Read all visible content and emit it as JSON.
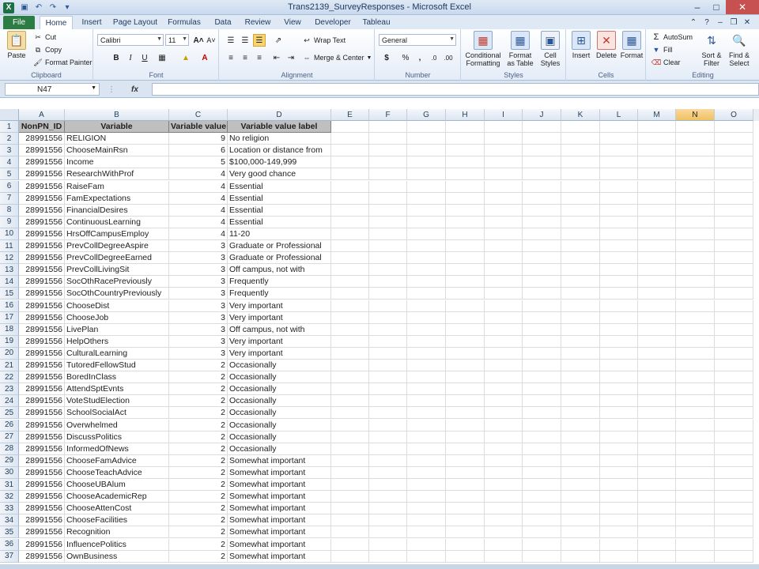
{
  "window": {
    "title": "Trans2139_SurveyResponses - Microsoft Excel",
    "app_icon": "X"
  },
  "tabs": {
    "file": "File",
    "items": [
      "Home",
      "Insert",
      "Page Layout",
      "Formulas",
      "Data",
      "Review",
      "View",
      "Developer",
      "Tableau"
    ],
    "active": "Home"
  },
  "ribbon": {
    "clipboard": {
      "label": "Clipboard",
      "paste": "Paste",
      "cut": "Cut",
      "copy": "Copy",
      "format_painter": "Format Painter"
    },
    "font": {
      "label": "Font",
      "name": "Calibri",
      "size": "11",
      "bold": "B",
      "italic": "I",
      "underline": "U"
    },
    "alignment": {
      "label": "Alignment",
      "wrap_text": "Wrap Text",
      "merge_center": "Merge & Center"
    },
    "number": {
      "label": "Number",
      "format": "General",
      "currency": "$",
      "percent": "%",
      "comma": ","
    },
    "styles": {
      "label": "Styles",
      "conditional_1": "Conditional",
      "conditional_2": "Formatting",
      "format_table_1": "Format",
      "format_table_2": "as Table",
      "cell_styles_1": "Cell",
      "cell_styles_2": "Styles"
    },
    "cells": {
      "label": "Cells",
      "insert": "Insert",
      "delete": "Delete",
      "format": "Format"
    },
    "editing": {
      "label": "Editing",
      "autosum": "AutoSum",
      "fill": "Fill",
      "clear": "Clear",
      "sort_1": "Sort &",
      "sort_2": "Filter",
      "find_1": "Find &",
      "find_2": "Select"
    }
  },
  "formula_bar": {
    "name_box": "N47",
    "fx": "fx",
    "content": ""
  },
  "columns": [
    "A",
    "B",
    "C",
    "D",
    "E",
    "F",
    "G",
    "H",
    "I",
    "J",
    "K",
    "L",
    "M",
    "N",
    "O"
  ],
  "selected_column": "N",
  "header_row": [
    "NonPN_ID",
    "Variable",
    "Variable value",
    "Variable value label"
  ],
  "rows": [
    [
      "28991556",
      "RELIGION",
      "9",
      "No religion"
    ],
    [
      "28991556",
      "ChooseMainRsn",
      "6",
      "Location or distance from"
    ],
    [
      "28991556",
      "Income",
      "5",
      "$100,000-149,999"
    ],
    [
      "28991556",
      "ResearchWithProf",
      "4",
      "Very good chance"
    ],
    [
      "28991556",
      "RaiseFam",
      "4",
      "Essential"
    ],
    [
      "28991556",
      "FamExpectations",
      "4",
      "Essential"
    ],
    [
      "28991556",
      "FinancialDesires",
      "4",
      "Essential"
    ],
    [
      "28991556",
      "ContinuousLearning",
      "4",
      "Essential"
    ],
    [
      "28991556",
      "HrsOffCampusEmploy",
      "4",
      "11-20"
    ],
    [
      "28991556",
      "PrevCollDegreeAspire",
      "3",
      "Graduate or Professional"
    ],
    [
      "28991556",
      "PrevCollDegreeEarned",
      "3",
      "Graduate or Professional"
    ],
    [
      "28991556",
      "PrevCollLivingSit",
      "3",
      "Off campus, not with"
    ],
    [
      "28991556",
      "SocOthRacePreviously",
      "3",
      "Frequently"
    ],
    [
      "28991556",
      "SocOthCountryPreviously",
      "3",
      "Frequently"
    ],
    [
      "28991556",
      "ChooseDist",
      "3",
      "Very important"
    ],
    [
      "28991556",
      "ChooseJob",
      "3",
      "Very important"
    ],
    [
      "28991556",
      "LivePlan",
      "3",
      "Off campus, not with"
    ],
    [
      "28991556",
      "HelpOthers",
      "3",
      "Very important"
    ],
    [
      "28991556",
      "CulturalLearning",
      "3",
      "Very important"
    ],
    [
      "28991556",
      "TutoredFellowStud",
      "2",
      "Occasionally"
    ],
    [
      "28991556",
      "BoredInClass",
      "2",
      "Occasionally"
    ],
    [
      "28991556",
      "AttendSptEvnts",
      "2",
      "Occasionally"
    ],
    [
      "28991556",
      "VoteStudElection",
      "2",
      "Occasionally"
    ],
    [
      "28991556",
      "SchoolSocialAct",
      "2",
      "Occasionally"
    ],
    [
      "28991556",
      "Overwhelmed",
      "2",
      "Occasionally"
    ],
    [
      "28991556",
      "DiscussPolitics",
      "2",
      "Occasionally"
    ],
    [
      "28991556",
      "InformedOfNews",
      "2",
      "Occasionally"
    ],
    [
      "28991556",
      "ChooseFamAdvice",
      "2",
      "Somewhat important"
    ],
    [
      "28991556",
      "ChooseTeachAdvice",
      "2",
      "Somewhat important"
    ],
    [
      "28991556",
      "ChooseUBAlum",
      "2",
      "Somewhat important"
    ],
    [
      "28991556",
      "ChooseAcademicRep",
      "2",
      "Somewhat important"
    ],
    [
      "28991556",
      "ChooseAttenCost",
      "2",
      "Somewhat important"
    ],
    [
      "28991556",
      "ChooseFacilities",
      "2",
      "Somewhat important"
    ],
    [
      "28991556",
      "Recognition",
      "2",
      "Somewhat important"
    ],
    [
      "28991556",
      "InfluencePolitics",
      "2",
      "Somewhat important"
    ],
    [
      "28991556",
      "OwnBusiness",
      "2",
      "Somewhat important"
    ]
  ]
}
